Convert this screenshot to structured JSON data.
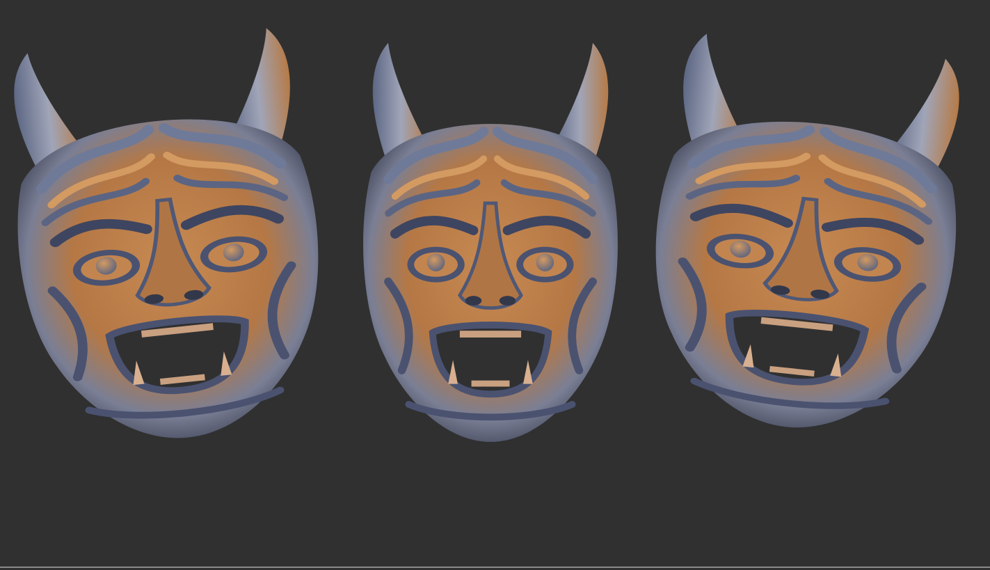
{
  "scene": {
    "background_color": "#303030",
    "material_colors": {
      "clay_orange": "#b97b46",
      "clay_highlight": "#dca46e",
      "shadow_blue": "#6b7794",
      "deep_shadow": "#262a36"
    },
    "models": [
      {
        "name": "hannya-mask-three-quarter-left"
      },
      {
        "name": "hannya-mask-front"
      },
      {
        "name": "hannya-mask-three-quarter-right"
      }
    ]
  }
}
